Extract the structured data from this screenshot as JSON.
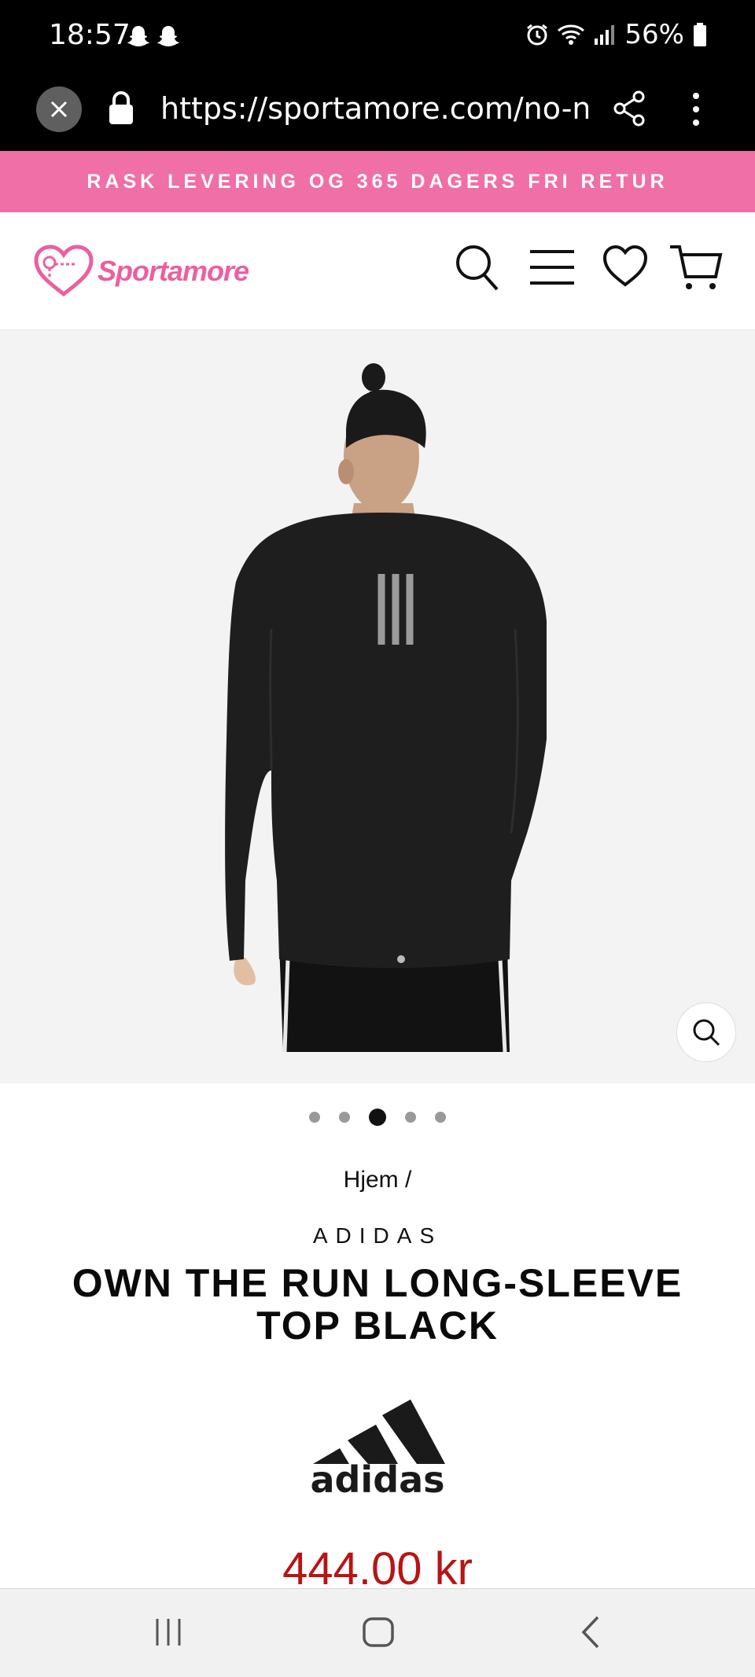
{
  "status_bar": {
    "time": "18:57",
    "battery": "56%"
  },
  "browser": {
    "url": "https://sportamore.com/no-no/p"
  },
  "promo": {
    "text": "RASK LEVERING OG 365 DAGERS FRI RETUR"
  },
  "header": {
    "logo_text": "Sportamore"
  },
  "gallery": {
    "slide_count": 5,
    "active_slide": 3
  },
  "product": {
    "breadcrumb": "Hjem /",
    "brand": "ADIDAS",
    "title": "OWN THE RUN LONG-SLEEVE TOP BLACK",
    "brand_logo_text": "adidas",
    "price": "444.00 kr"
  },
  "colors": {
    "accent": "#ef6fa6",
    "logo": "#ec5f9f",
    "price": "#b81414"
  }
}
